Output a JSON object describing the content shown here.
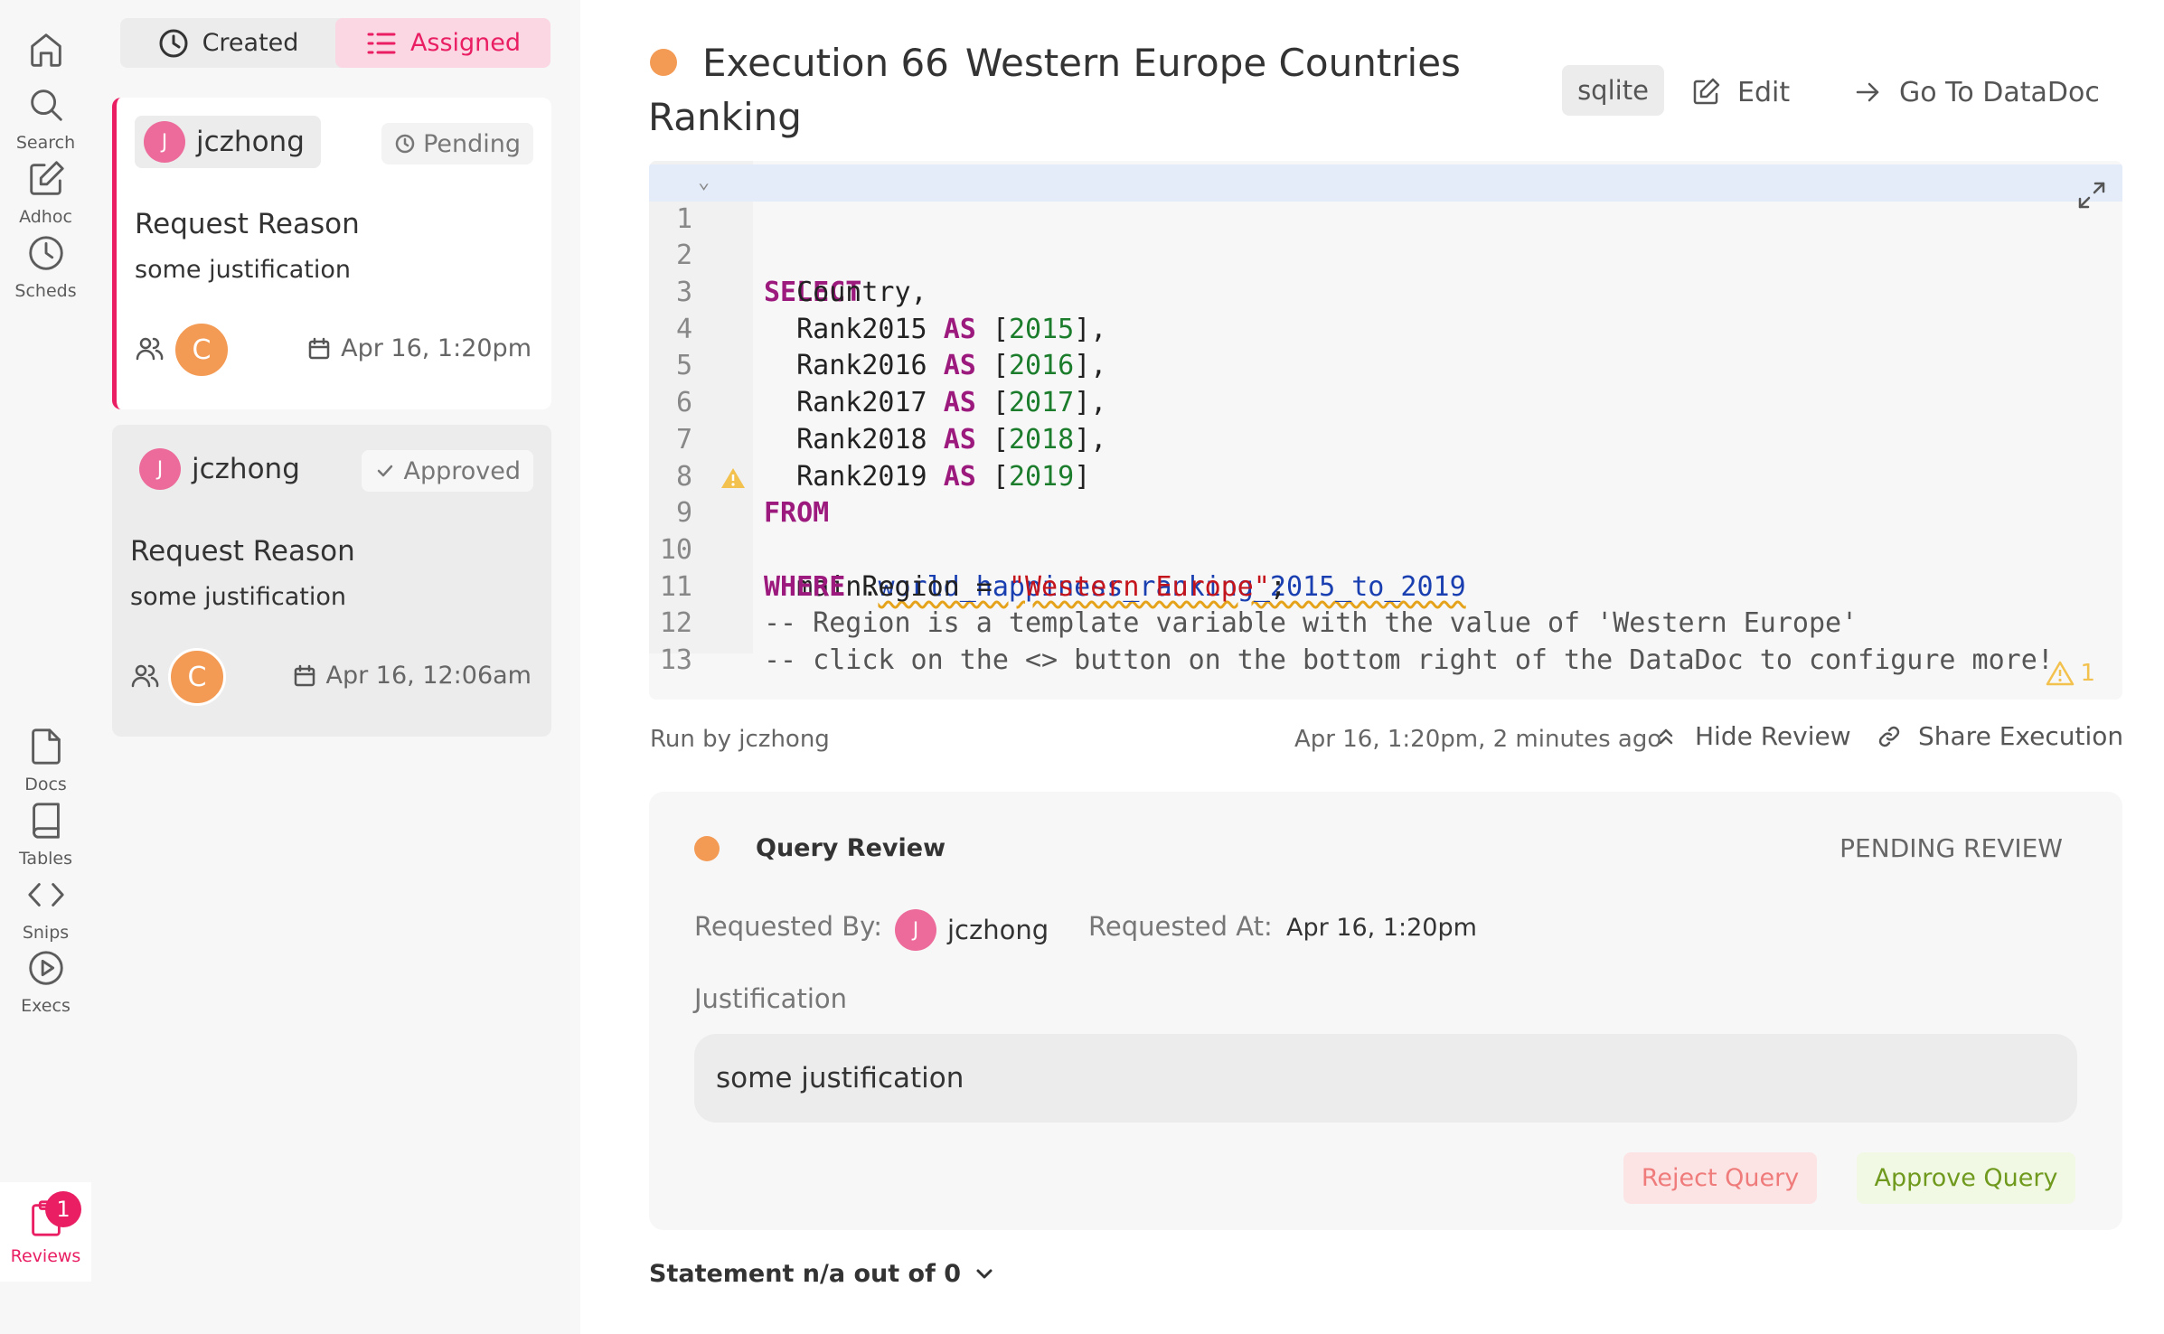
{
  "nav": {
    "items": [
      {
        "label": ""
      },
      {
        "label": "Search"
      },
      {
        "label": "Adhoc"
      },
      {
        "label": "Scheds"
      },
      {
        "label": "Docs"
      },
      {
        "label": "Tables"
      },
      {
        "label": "Snips"
      },
      {
        "label": "Execs"
      },
      {
        "label": "Reviews",
        "badge": "1",
        "active": true
      }
    ]
  },
  "list": {
    "tabs": [
      {
        "label": "Created",
        "icon": "clock-icon"
      },
      {
        "label": "Assigned",
        "icon": "list-icon",
        "active": true
      }
    ],
    "cards": [
      {
        "user_initial": "J",
        "user": "jczhong",
        "status": "Pending",
        "title": "Request Reason",
        "text": "some justification",
        "reviewer_initial": "C",
        "date": "Apr 16, 1:20pm",
        "selected": true
      },
      {
        "user_initial": "J",
        "user": "jczhong",
        "status": "Approved",
        "title": "Request Reason",
        "text": "some justification",
        "reviewer_initial": "C",
        "date": "Apr 16, 12:06am",
        "selected": false
      }
    ]
  },
  "main": {
    "title_prefix": "Execution 66",
    "title_name": "Western Europe Countries Ranking",
    "engine": "sqlite",
    "edit_label": "Edit",
    "go_label": "Go To DataDoc",
    "warning_count": "1",
    "run_by": "Run by jczhong",
    "run_time": "Apr 16, 1:20pm, 2 minutes ago",
    "hide_review_label": "Hide Review",
    "share_label": "Share Execution",
    "statement_label": "Statement n/a out of 0"
  },
  "code": {
    "line_numbers": [
      "1",
      "2",
      "3",
      "4",
      "5",
      "6",
      "7",
      "8",
      "9",
      "10",
      "11",
      "12",
      "13"
    ],
    "tokens": {
      "select": "SELECT",
      "country": "  Country,",
      "ranks": [
        {
          "col": "  Rank2015 ",
          "kw": "AS",
          "alias": "2015",
          "end": "],"
        },
        {
          "col": "  Rank2016 ",
          "kw": "AS",
          "alias": "2016",
          "end": "],"
        },
        {
          "col": "  Rank2017 ",
          "kw": "AS",
          "alias": "2017",
          "end": "],"
        },
        {
          "col": "  Rank2018 ",
          "kw": "AS",
          "alias": "2018",
          "end": "],"
        },
        {
          "col": "  Rank2019 ",
          "kw": "AS",
          "alias": "2019",
          "end": "]"
        }
      ],
      "from": "FROM",
      "schema": "  main.",
      "table": "world_happiness_ranking_2015_to_2019",
      "where": "WHERE",
      "where_col": " Region = ",
      "where_val": "\"Western Europe\"",
      "where_end": ";",
      "comment1": "-- Region is a template variable with the value of 'Western Europe'",
      "comment2": "-- click on the <> button on the bottom right of the DataDoc to configure more!"
    }
  },
  "review": {
    "title": "Query Review",
    "status": "PENDING REVIEW",
    "requested_by_label": "Requested By:",
    "requester_initial": "J",
    "requester": "jczhong",
    "requested_at_label": "Requested At:",
    "requested_at": "Apr 16, 1:20pm",
    "justification_label": "Justification",
    "justification": "some justification",
    "reject_label": "Reject Query",
    "approve_label": "Approve Query"
  },
  "colors": {
    "accent": "#e91e63",
    "status_dot": "#f39a54",
    "reject": "#ef7b7b",
    "approve": "#6f9a1e"
  }
}
